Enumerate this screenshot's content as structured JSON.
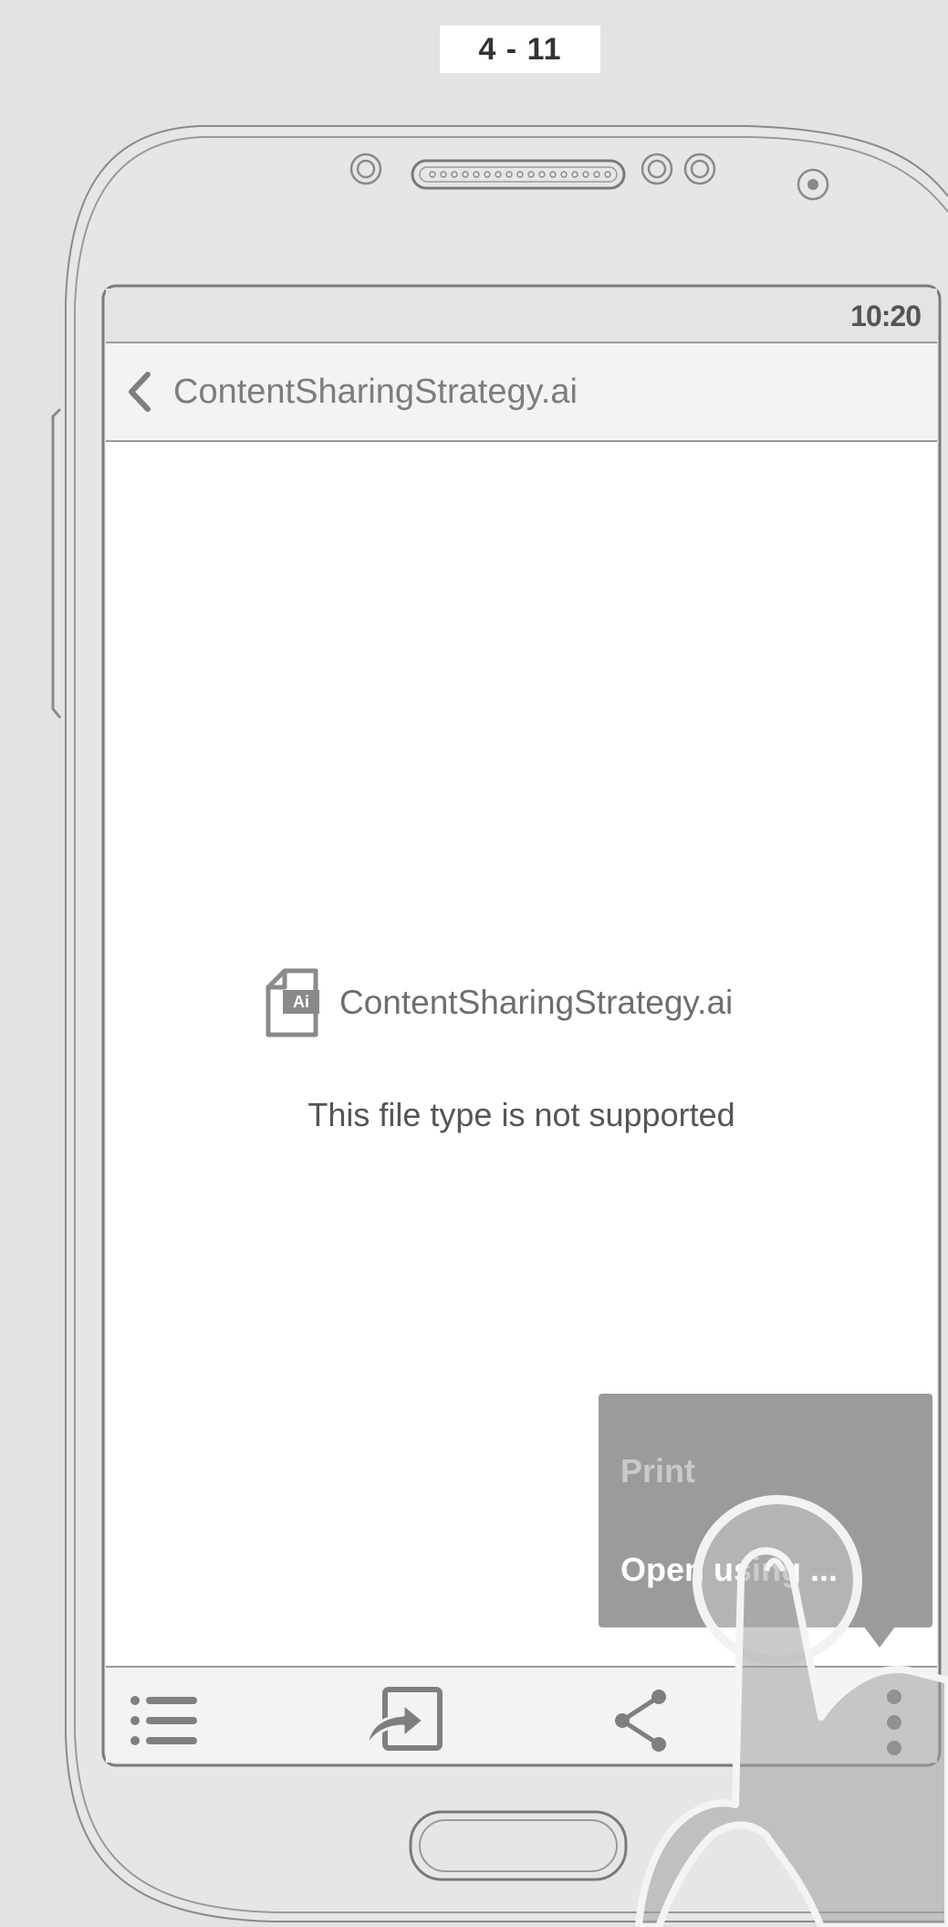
{
  "step_label": "4 - 11",
  "status_bar": {
    "time": "10:20"
  },
  "header": {
    "title": "ContentSharingStrategy.ai",
    "back_icon": "chevron-left-icon"
  },
  "main": {
    "file_badge": "Ai",
    "file_name": "ContentSharingStrategy.ai",
    "message": "This file type is not supported"
  },
  "overflow_menu": {
    "items": [
      {
        "label": "Print",
        "enabled": false
      },
      {
        "label": "Open using ...",
        "enabled": true
      }
    ]
  },
  "bottom_toolbar": {
    "icons": [
      "list-icon",
      "open-in-icon",
      "share-icon",
      "more-vertical-icon"
    ]
  },
  "colors": {
    "background": "#e3e3e3",
    "bars": "#f3f3f3",
    "menu": "#9b9b9b",
    "icon": "#7f7f7f"
  }
}
